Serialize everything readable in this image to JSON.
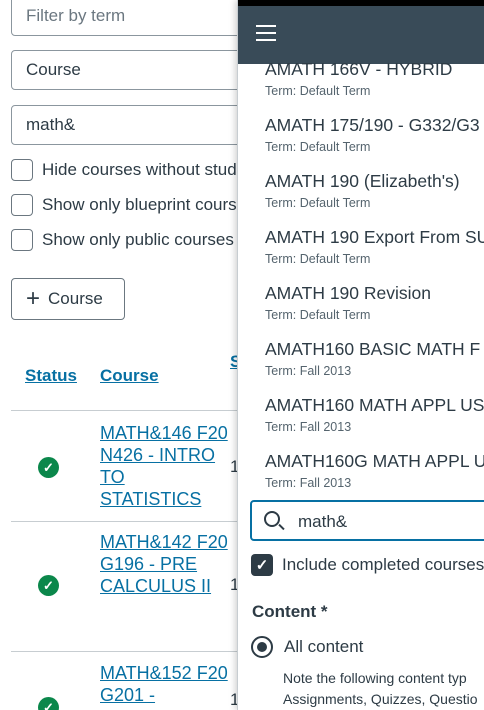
{
  "filters": {
    "term_placeholder": "Filter by term",
    "type_value": "Course",
    "search_value": "math&",
    "checkboxes": [
      "Hide courses without students",
      "Show only blueprint courses",
      "Show only public courses"
    ],
    "add_course_label": "Course"
  },
  "table": {
    "headers": {
      "status": "Status",
      "course": "Course",
      "sis": "S"
    },
    "rows": [
      {
        "course": "MATH&146 F20 N426 - INTRO TO STATISTICS",
        "num": "1"
      },
      {
        "course": "MATH&142 F20 G196 - PRE CALCULUS II",
        "num": "1"
      },
      {
        "course": "MATH&152 F20 G201 -",
        "num": "1"
      }
    ],
    "status_icon": "check-circle-icon",
    "status_color": "#0b874b"
  },
  "panel": {
    "menu_icon": "hamburger-icon",
    "header_color": "#394b58",
    "results": [
      {
        "name": "AMATH 166V - HYBRID",
        "term": "Term: Default Term"
      },
      {
        "name": "AMATH 175/190 - G332/G3",
        "term": "Term: Default Term"
      },
      {
        "name": "AMATH 190 (Elizabeth's)",
        "term": "Term: Default Term"
      },
      {
        "name": "AMATH 190 Export From SU",
        "term": "Term: Default Term"
      },
      {
        "name": "AMATH 190 Revision",
        "term": "Term: Default Term"
      },
      {
        "name": "AMATH160 BASIC MATH F",
        "term": "Term: Fall 2013"
      },
      {
        "name": "AMATH160 MATH APPL US",
        "term": "Term: Fall 2013"
      },
      {
        "name": "AMATH160G MATH APPL U",
        "term": "Term: Fall 2013"
      }
    ],
    "search_value": "math&",
    "include_completed_label": "Include completed courses",
    "content_label": "Content *",
    "all_content_label": "All content",
    "note_lines": [
      "Note the following content typ",
      "Assignments, Quizzes, Questio"
    ],
    "accent_color": "#0770a3"
  }
}
